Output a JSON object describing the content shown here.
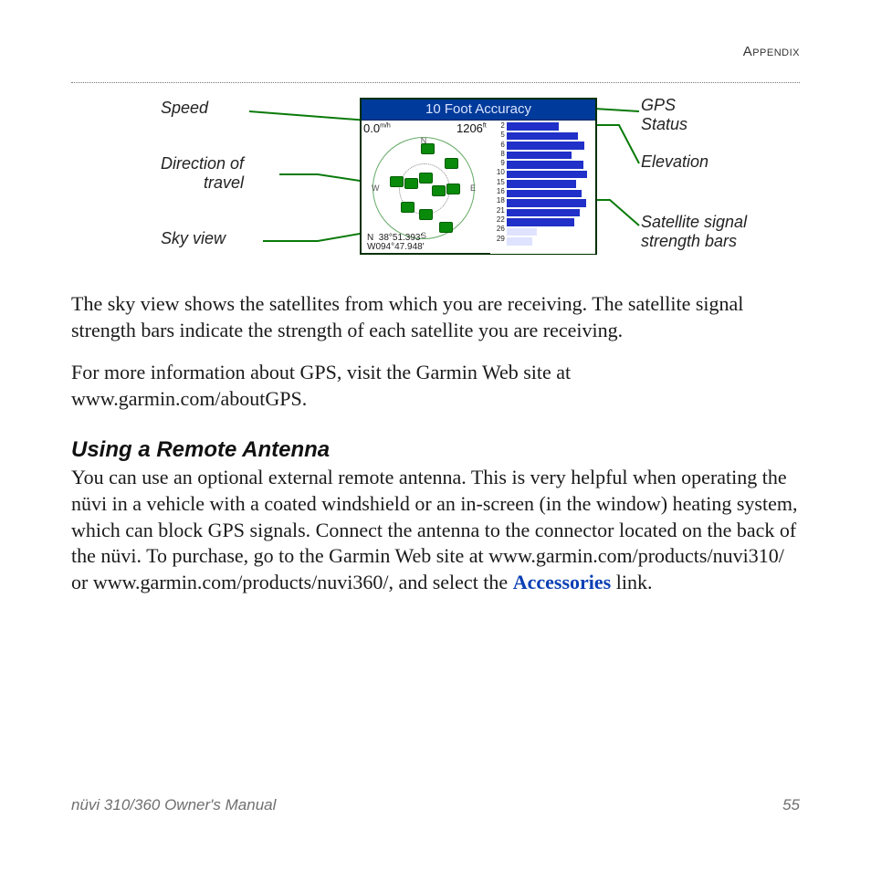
{
  "header": {
    "section_label": "Appendix"
  },
  "figure": {
    "callouts": {
      "speed": "Speed",
      "direction_of_travel": "Direction of\ntravel",
      "sky_view": "Sky view",
      "gps_status": "GPS\nStatus",
      "elevation": "Elevation",
      "signal_bars": "Satellite signal\nstrength bars"
    },
    "screen": {
      "title": "10 Foot Accuracy",
      "speed": "0.0",
      "speed_unit": "m/h",
      "elevation": "1206",
      "elevation_unit": "ft",
      "compass": {
        "n": "N",
        "s": "S",
        "e": "E",
        "w": "W"
      },
      "coord_lat": "N  38°51.393'",
      "coord_lon": "W094°47.948'",
      "bar_labels": [
        "2",
        "5",
        "6",
        "8",
        "9",
        "10",
        "15",
        "16",
        "18",
        "21",
        "22",
        "26",
        "29"
      ]
    }
  },
  "paragraphs": {
    "p1": "The sky view shows the satellites from which you are receiving. The satellite signal strength bars indicate the strength of each satellite you are receiving.",
    "p2": "For more information about GPS, visit the Garmin Web site at www.garmin.com/aboutGPS."
  },
  "subheading": "Using a Remote Antenna",
  "antenna": {
    "text_before": "You can use an optional external remote antenna. This is very helpful when operating the nüvi in a vehicle with a coated windshield or an in-screen (in the window) heating system, which can block GPS signals. Connect the antenna to the connector located on the back of the nüvi. To purchase, go to the Garmin Web site at www.garmin.com/products/nuvi310/ or www.garmin.com/products/nuvi360/, and select the ",
    "link_text": "Accessories",
    "text_after": " link."
  },
  "footer": {
    "manual_title": "nüvi 310/360 Owner's Manual",
    "page_number": "55"
  }
}
